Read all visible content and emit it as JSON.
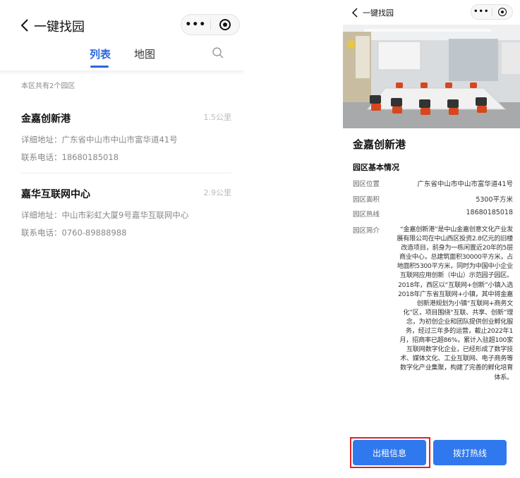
{
  "left": {
    "nav_title": "一键找园",
    "capsule_dots": "•••",
    "tabs": [
      {
        "label": "列表",
        "active": true
      },
      {
        "label": "地图",
        "active": false
      }
    ],
    "count_text": "本区共有2个园区",
    "parks": [
      {
        "name": "金嘉创新港",
        "distance": "1.5公里",
        "address": "详细地址：广东省中山市中山市富华道41号",
        "phone": "联系电话：18680185018"
      },
      {
        "name": "嘉华互联网中心",
        "distance": "2.9公里",
        "address": "详细地址：中山市彩虹大厦9号嘉华互联网中心",
        "phone": "联系电话：0760-89888988"
      }
    ]
  },
  "right": {
    "nav_title": "一键找园",
    "capsule_dots": "•••",
    "park_name": "金嘉创新港",
    "section_title": "园区基本情况",
    "rows": [
      {
        "label": "园区位置",
        "value": "广东省中山市中山市富华道41号"
      },
      {
        "label": "园区面积",
        "value": "5300平方米"
      },
      {
        "label": "园区热线",
        "value": "18680185018"
      },
      {
        "label": "园区简介",
        "value": "“金嘉创新港”是中山金嘉创意文化产业发展有限公司在中山西区投资2.8亿元的旧楼改造项目，前身为一栋闲置近20年的5层商业中心，总建筑面积30000平方米，占地面积5300平方米，同时为中国中小企业互联网应用创新（中山）示范园子园区。2018年，西区以“互联网+创新”小镇入选2018年广东省互联网+小镇，其中将金嘉创新港规划为小镇“互联网+商务文化”区，项目围绕“互联、共享、创新”理念，为初创企业和团队提供创业孵化服务，经过三年多的运营，截止2022年1月，招商率已超86%，累计入驻超100家互联网数字化企业，已经形成了数字技术、媒体文化、工业互联网、电子商务等数字化产业集聚，构建了完善的孵化培育体系。"
      }
    ],
    "buttons": {
      "rent": "出租信息",
      "call": "拨打热线"
    }
  },
  "colors": {
    "accent": "#2a67e0",
    "button": "#2f78ee",
    "highlight": "#e0222a"
  }
}
